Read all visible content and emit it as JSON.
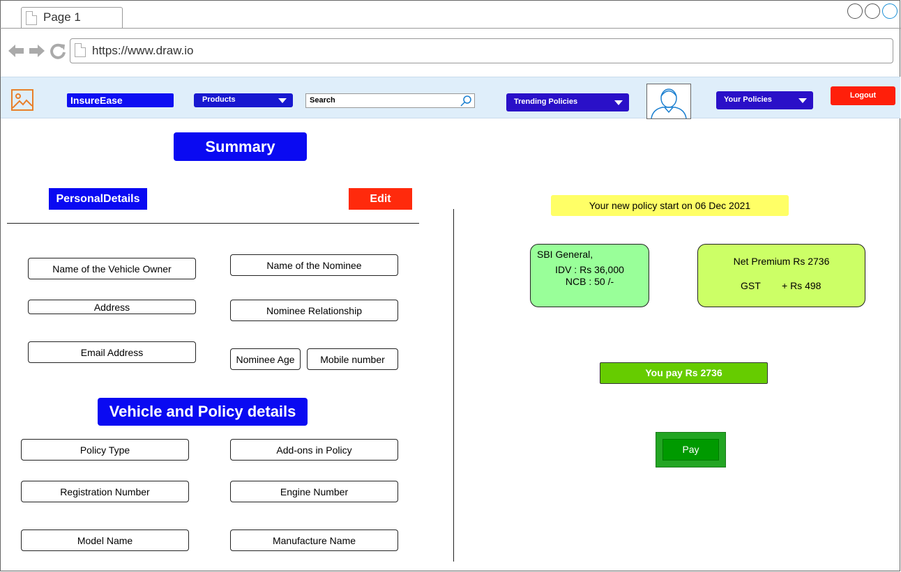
{
  "browser": {
    "tab_title": "Page 1",
    "url": "https://www.draw.io"
  },
  "header": {
    "brand": "InsureEase",
    "products_label": "Products",
    "search_placeholder": "Search",
    "trending_label": "Trending Policies",
    "your_policies_label": "Your Policies",
    "logout_label": "Logout",
    "colors": {
      "bar": "#dfeefa",
      "nav_pill": "#2a10c8",
      "logout": "#ff1f0a"
    }
  },
  "summary": {
    "title": "Summary",
    "personal_heading": "PersonalDetails",
    "edit_label": "Edit",
    "personal_fields": {
      "owner_name": "Name of the Vehicle Owner",
      "address": "Address",
      "email": "Email Address",
      "nominee_name": "Name of the Nominee",
      "nominee_relationship": "Nominee Relationship",
      "nominee_age": "Nominee Age",
      "mobile": "Mobile number"
    },
    "vehicle_heading": "Vehicle and Policy details",
    "vehicle_fields": {
      "policy_type": "Policy Type",
      "registration_number": "Registration Number",
      "model_name": "Model Name",
      "addons": "Add-ons in Policy",
      "engine_number": "Engine Number",
      "manufacture_name": "Manufacture Name"
    }
  },
  "payment": {
    "notice": "Your new policy start on 06 Dec 2021",
    "insurer": "SBI General,",
    "idv": "IDV : Rs 36,000",
    "ncb": "NCB : 50 /-",
    "net_premium": "Net Premium Rs 2736",
    "gst_label": "GST",
    "gst_value": "+ Rs 498",
    "you_pay": "You pay Rs 2736",
    "pay_label": "Pay"
  }
}
